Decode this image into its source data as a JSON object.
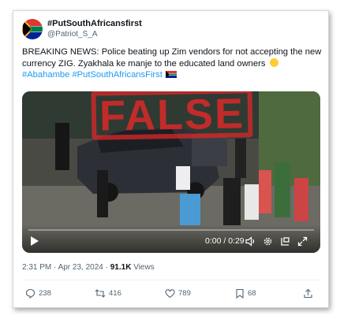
{
  "tweet": {
    "display_name": "#PutSouthAfricansfirst",
    "handle": "@Patriot_S_A",
    "text_main": "BREAKING NEWS: Police beating up Zim vendors for not accepting the new currency ZIG. Zyakhala ke manje to the educated land owners",
    "hashtags": "#Abahambe #PutSouthAfricansFirst",
    "timestamp": "2:31 PM · Apr 23, 2024 · ",
    "views_count": "91.1K",
    "views_label": " Views"
  },
  "video": {
    "stamp_text": "FALSE",
    "time": "0:00 / 0:29"
  },
  "actions": {
    "replies": "238",
    "retweets": "416",
    "likes": "789",
    "bookmarks": "68"
  },
  "colors": {
    "accent": "#1d9bf0",
    "stamp": "#e02828"
  }
}
